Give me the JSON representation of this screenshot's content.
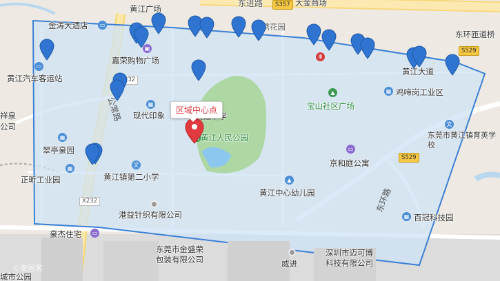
{
  "map": {
    "callout_label": "区域中心点",
    "pin_count": 22,
    "watermark": "©安居客",
    "places": {
      "huangjiang_plaza": "黄江广场",
      "dajin_mall": "大金商场",
      "jintao_hotel": "金涛大酒店",
      "jinxiu_garden": "锦绣花园",
      "donghuan_road_top": "东环匝道桥",
      "jiarong_mall": "嘉荣购物广场",
      "bus_station": "黄江汽车客运站",
      "xiangfu": "祥泉",
      "gongsi": "公司",
      "modern_print": "现代印象",
      "middle_school": "黄江中学",
      "park": "黄江人民公园",
      "baoshan_plaza": "宝山社区广场",
      "jitianggang": "鸡啼岗工业区",
      "huangjiang_road": "黄江大道",
      "yuying_school": "东莞市黄江镇育英学校",
      "cuiting": "翠亭豪园",
      "jinghe_apartment": "京和庭公寓",
      "zhengxin": "正昕工业园",
      "no2_primary": "黄江镇第二小学",
      "kindergarten": "黄江中心幼儿园",
      "donghuan_road": "东环路",
      "gangyi": "港益针织有限公司",
      "baiguan": "百冠科技园",
      "haojie": "豪杰住宅",
      "jinshengrong": "东莞市金盛荣包装有限公司",
      "weijin": "威进",
      "shenzhen_maikebo": "深圳市迈可博科技有限公司",
      "city_park": "城市公园",
      "gongchang_road": "公常路",
      "dongjin_road": "东进路"
    },
    "roads": {
      "s357": "S357",
      "s529_a": "S529",
      "s529_b": "S529",
      "x232_a": "X232",
      "x232_b": "X232"
    },
    "colors": {
      "boundary": "#3a7fd5",
      "fill": "#cfe3f5",
      "pin": "#2f74d0",
      "center_pin": "#e0393e",
      "park": "#a9d59a"
    }
  }
}
